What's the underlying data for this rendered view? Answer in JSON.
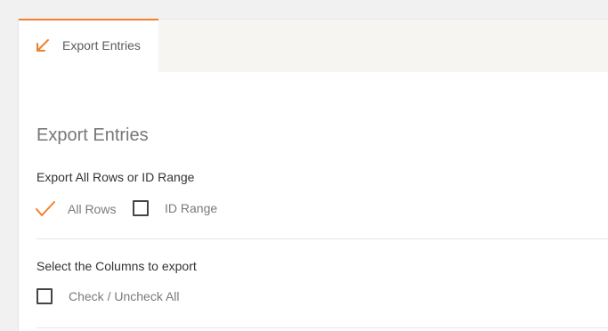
{
  "tabs": [
    {
      "label": "Export Entries",
      "icon": "arrow-down-left-icon",
      "active": true
    }
  ],
  "main": {
    "title": "Export Entries",
    "export_rows": {
      "label": "Export All Rows or ID Range",
      "options": [
        {
          "label": "All Rows",
          "checked": true
        },
        {
          "label": "ID Range",
          "checked": false
        }
      ]
    },
    "columns": {
      "label": "Select the Columns to export",
      "toggle_all": {
        "label": "Check / Uncheck All",
        "checked": false
      }
    }
  },
  "colors": {
    "accent": "#f37f2b",
    "tabbar_bg": "#f6f5f1",
    "page_bg": "#f1f1f1"
  }
}
